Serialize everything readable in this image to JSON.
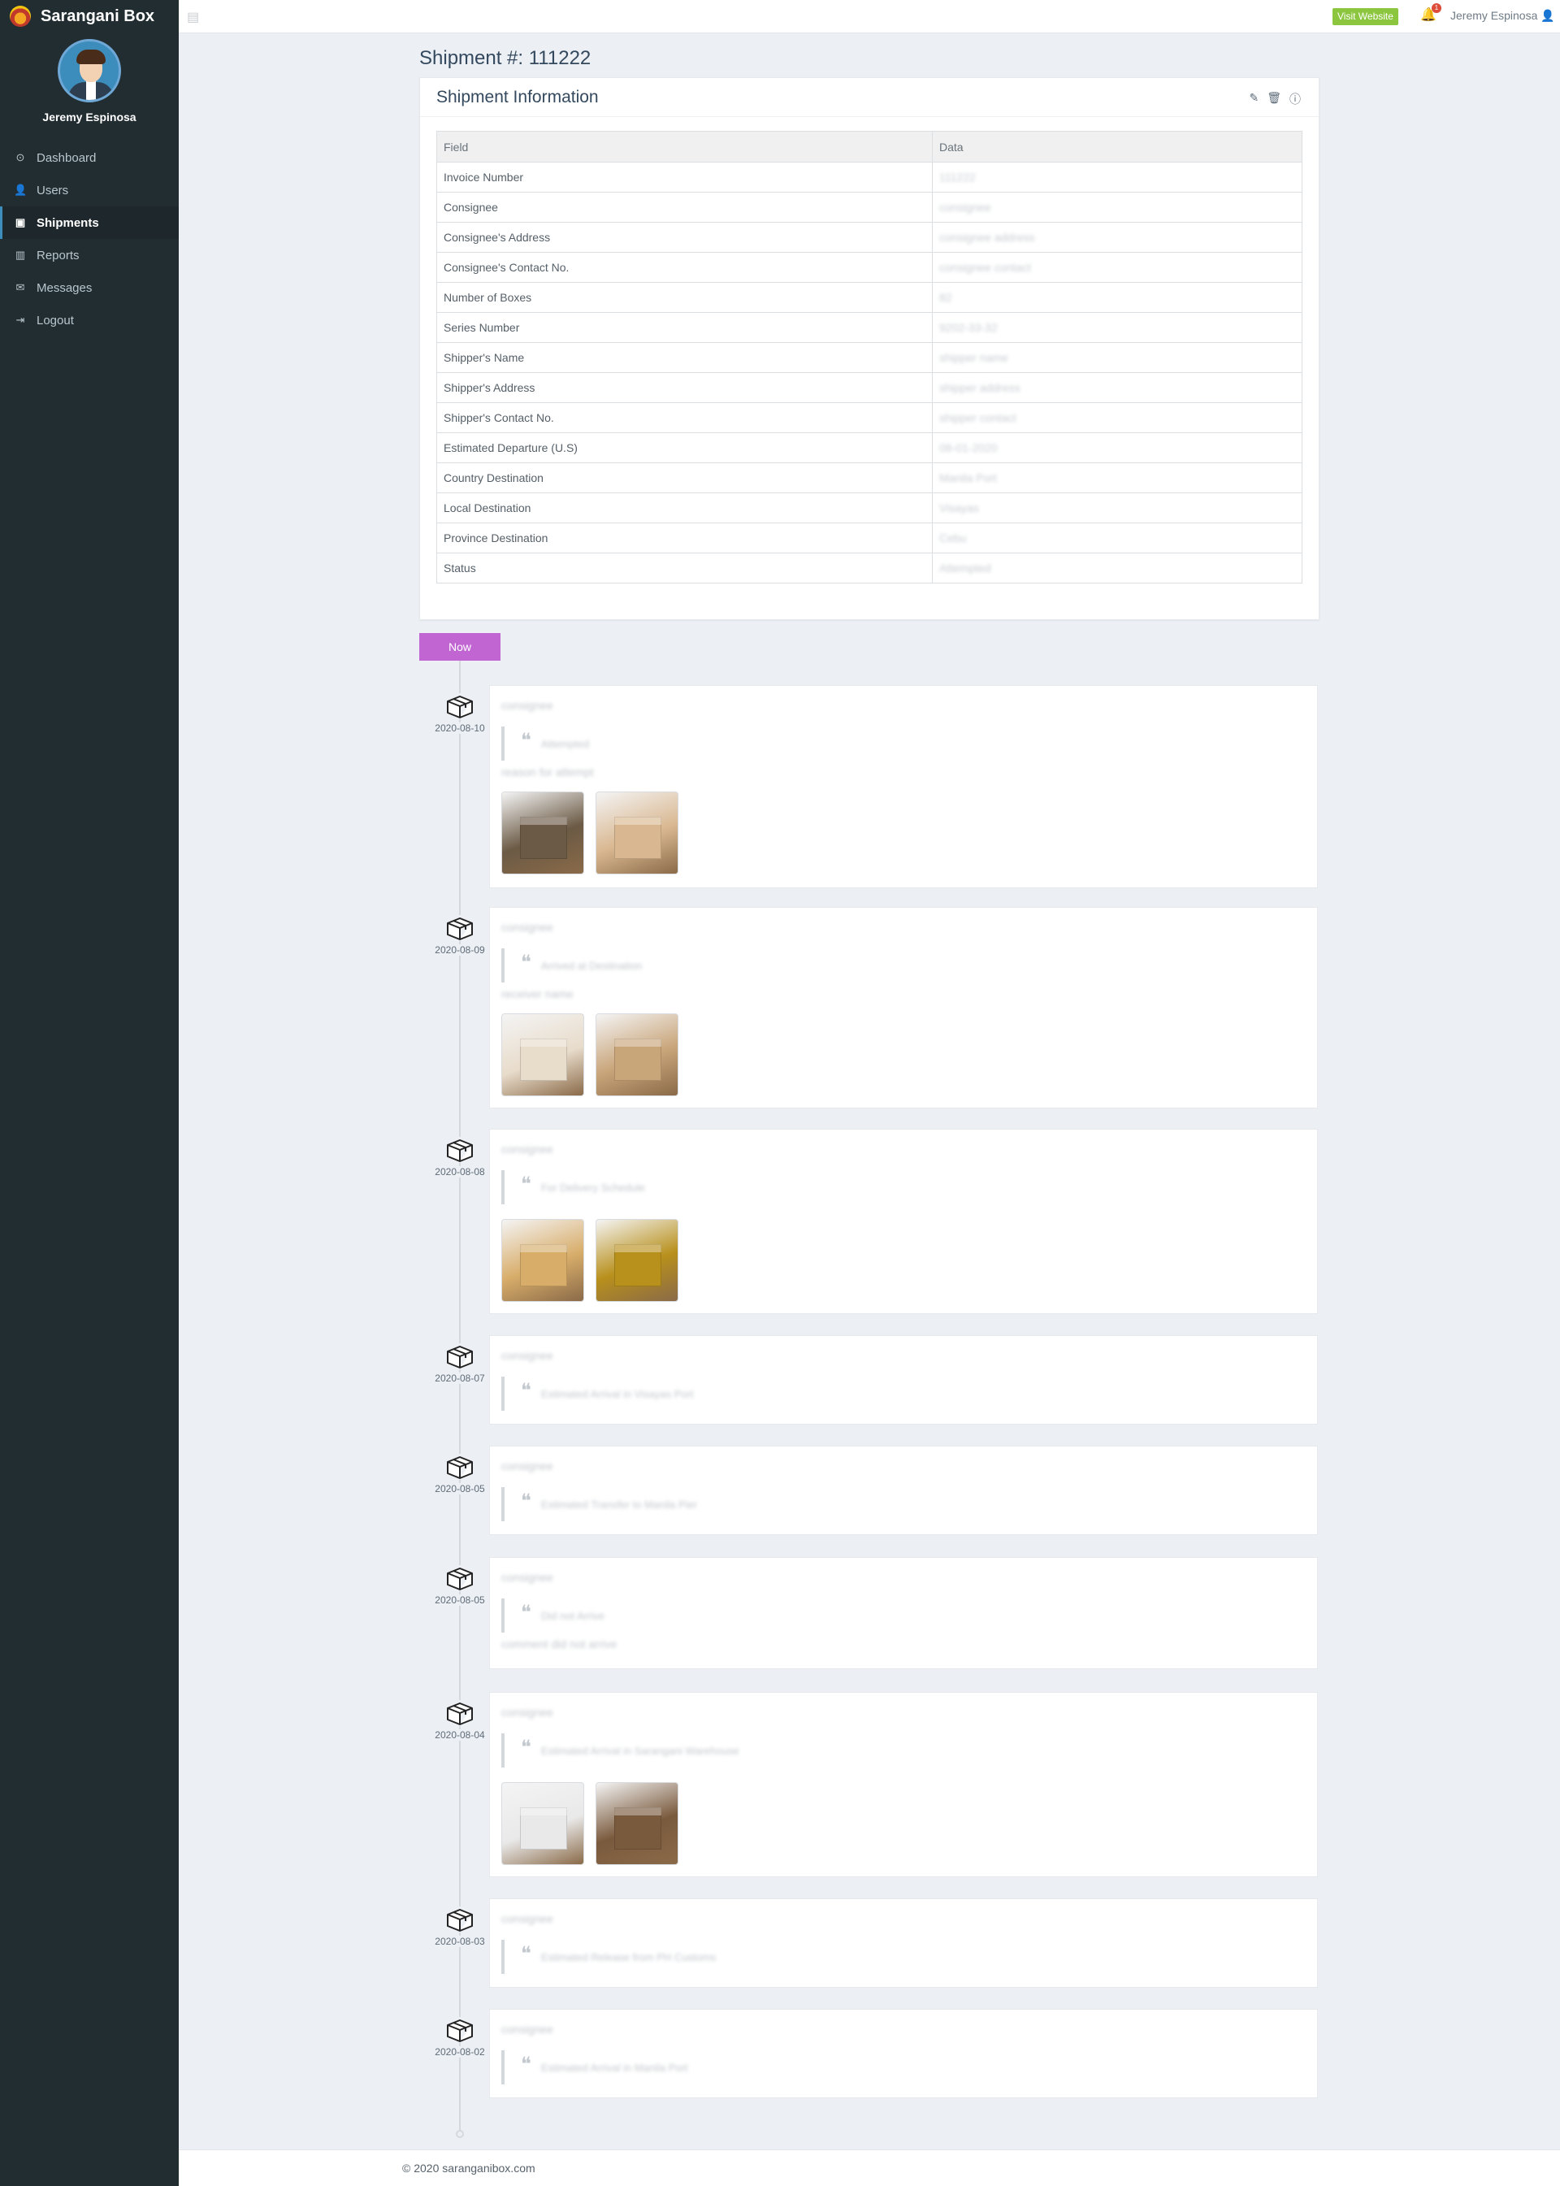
{
  "brand": {
    "name": "Sarangani Box"
  },
  "sidebar": {
    "user_name": "Jeremy Espinosa",
    "items": [
      {
        "label": "Dashboard",
        "icon": "dashboard-icon",
        "glyph": "⊙",
        "active": false
      },
      {
        "label": "Users",
        "icon": "user-icon",
        "glyph": "👤",
        "active": false
      },
      {
        "label": "Shipments",
        "icon": "briefcase-icon",
        "glyph": "▣",
        "active": true
      },
      {
        "label": "Reports",
        "icon": "bar-chart-icon",
        "glyph": "▥",
        "active": false
      },
      {
        "label": "Messages",
        "icon": "envelope-icon",
        "glyph": "✉",
        "active": false
      },
      {
        "label": "Logout",
        "icon": "sign-out-icon",
        "glyph": "⇥",
        "active": false
      }
    ]
  },
  "topbar": {
    "visit_label": "Visit Website",
    "notification_count": "1",
    "user_name": "Jeremy Espinosa"
  },
  "page": {
    "title": "Shipment #: 111222"
  },
  "card": {
    "title": "Shipment Information",
    "columns": [
      "Field",
      "Data"
    ],
    "rows": [
      {
        "field": "Invoice Number",
        "data": "111222"
      },
      {
        "field": "Consignee",
        "data": "consignee"
      },
      {
        "field": "Consignee's Address",
        "data": "consignee address"
      },
      {
        "field": "Consignee's Contact No.",
        "data": "consignee contact"
      },
      {
        "field": "Number of Boxes",
        "data": "82"
      },
      {
        "field": "Series Number",
        "data": "9202-33-32"
      },
      {
        "field": "Shipper's Name",
        "data": "shipper name"
      },
      {
        "field": "Shipper's Address",
        "data": "shipper address"
      },
      {
        "field": "Shipper's Contact No.",
        "data": "shipper contact"
      },
      {
        "field": "Estimated Departure (U.S)",
        "data": "08-01-2020"
      },
      {
        "field": "Country Destination",
        "data": "Manila Port"
      },
      {
        "field": "Local Destination",
        "data": "Visayas"
      },
      {
        "field": "Province Destination",
        "data": "Cebu"
      },
      {
        "field": "Status",
        "data": "Attempted"
      }
    ]
  },
  "timeline": {
    "now_label": "Now",
    "entries": [
      {
        "date": "2020-08-10",
        "name": "consignee",
        "status": "Attempted",
        "comment": "reason for attempt",
        "images": 2
      },
      {
        "date": "2020-08-09",
        "name": "consignee",
        "status": "Arrived at Destination",
        "comment": "receiver name",
        "images": 2
      },
      {
        "date": "2020-08-08",
        "name": "consignee",
        "status": "For Delivery Schedule",
        "comment": "",
        "images": 2
      },
      {
        "date": "2020-08-07",
        "name": "consignee",
        "status": "Estimated Arrival in Visayas Port",
        "comment": "",
        "images": 0
      },
      {
        "date": "2020-08-05",
        "name": "consignee",
        "status": "Estimated Transfer to Manila Pier",
        "comment": "",
        "images": 0
      },
      {
        "date": "2020-08-05",
        "name": "consignee",
        "status": "Did not Arrive",
        "comment": "comment did not arrive",
        "images": 0
      },
      {
        "date": "2020-08-04",
        "name": "consignee",
        "status": "Estimated Arrival in Sarangani Warehouse",
        "comment": "",
        "images": 2
      },
      {
        "date": "2020-08-03",
        "name": "consignee",
        "status": "Estimated Release from PH Customs",
        "comment": "",
        "images": 0
      },
      {
        "date": "2020-08-02",
        "name": "consignee",
        "status": "Estimated Arrival in Manila Port",
        "comment": "",
        "images": 0
      }
    ]
  },
  "footer": {
    "text": "© 2020 saranganibox.com"
  }
}
